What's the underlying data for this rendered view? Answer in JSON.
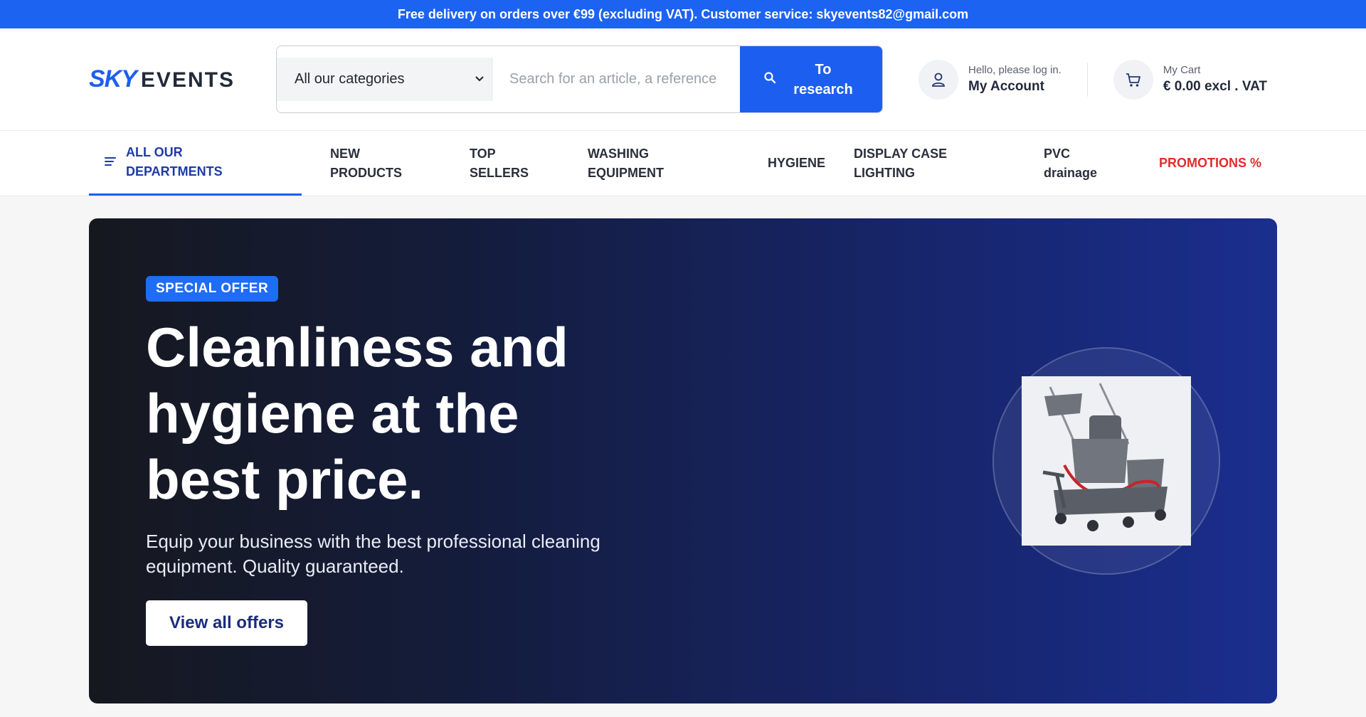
{
  "topbar": {
    "text": "Free delivery on orders over €99 (excluding VAT). Customer service: skyevents82@gmail.com"
  },
  "header": {
    "logo": {
      "primary": "SKY",
      "secondary": "EVENTS"
    },
    "category_select": "All our categories",
    "search_placeholder": "Search for an article, a reference",
    "search_button": "To research",
    "account": {
      "greeting": "Hello, please log in.",
      "label": "My Account"
    },
    "cart": {
      "label": "My Cart",
      "total": "€ 0.00 excl . VAT"
    }
  },
  "nav": {
    "departments": "ALL OUR DEPARTMENTS",
    "items": [
      "NEW PRODUCTS",
      "TOP SELLERS",
      "WASHING EQUIPMENT",
      "HYGIENE",
      "DISPLAY CASE LIGHTING",
      "PVC drainage",
      "PROMOTIONS %"
    ]
  },
  "hero": {
    "badge": "SPECIAL OFFER",
    "title": "Cleanliness and hygiene at the best price.",
    "subtitle": "Equip your business with the best professional cleaning equipment. Quality guaranteed.",
    "cta": "View all offers"
  },
  "icons": [
    "search-icon",
    "user-icon",
    "cart-icon",
    "menu-icon",
    "chevron-down-icon"
  ],
  "colors": {
    "brand_blue": "#1c5ff0",
    "promo_red": "#e32b2b",
    "hero_dark": "#16181f",
    "hero_blue": "#1a2e8e"
  }
}
